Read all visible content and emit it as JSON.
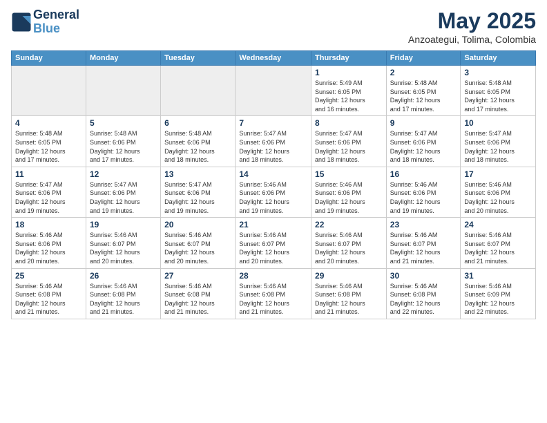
{
  "header": {
    "logo_line1": "General",
    "logo_line2": "Blue",
    "month": "May 2025",
    "location": "Anzoategui, Tolima, Colombia"
  },
  "weekdays": [
    "Sunday",
    "Monday",
    "Tuesday",
    "Wednesday",
    "Thursday",
    "Friday",
    "Saturday"
  ],
  "weeks": [
    [
      {
        "day": "",
        "info": ""
      },
      {
        "day": "",
        "info": ""
      },
      {
        "day": "",
        "info": ""
      },
      {
        "day": "",
        "info": ""
      },
      {
        "day": "1",
        "info": "Sunrise: 5:49 AM\nSunset: 6:05 PM\nDaylight: 12 hours\nand 16 minutes."
      },
      {
        "day": "2",
        "info": "Sunrise: 5:48 AM\nSunset: 6:05 PM\nDaylight: 12 hours\nand 17 minutes."
      },
      {
        "day": "3",
        "info": "Sunrise: 5:48 AM\nSunset: 6:05 PM\nDaylight: 12 hours\nand 17 minutes."
      }
    ],
    [
      {
        "day": "4",
        "info": "Sunrise: 5:48 AM\nSunset: 6:05 PM\nDaylight: 12 hours\nand 17 minutes."
      },
      {
        "day": "5",
        "info": "Sunrise: 5:48 AM\nSunset: 6:06 PM\nDaylight: 12 hours\nand 17 minutes."
      },
      {
        "day": "6",
        "info": "Sunrise: 5:48 AM\nSunset: 6:06 PM\nDaylight: 12 hours\nand 18 minutes."
      },
      {
        "day": "7",
        "info": "Sunrise: 5:47 AM\nSunset: 6:06 PM\nDaylight: 12 hours\nand 18 minutes."
      },
      {
        "day": "8",
        "info": "Sunrise: 5:47 AM\nSunset: 6:06 PM\nDaylight: 12 hours\nand 18 minutes."
      },
      {
        "day": "9",
        "info": "Sunrise: 5:47 AM\nSunset: 6:06 PM\nDaylight: 12 hours\nand 18 minutes."
      },
      {
        "day": "10",
        "info": "Sunrise: 5:47 AM\nSunset: 6:06 PM\nDaylight: 12 hours\nand 18 minutes."
      }
    ],
    [
      {
        "day": "11",
        "info": "Sunrise: 5:47 AM\nSunset: 6:06 PM\nDaylight: 12 hours\nand 19 minutes."
      },
      {
        "day": "12",
        "info": "Sunrise: 5:47 AM\nSunset: 6:06 PM\nDaylight: 12 hours\nand 19 minutes."
      },
      {
        "day": "13",
        "info": "Sunrise: 5:47 AM\nSunset: 6:06 PM\nDaylight: 12 hours\nand 19 minutes."
      },
      {
        "day": "14",
        "info": "Sunrise: 5:46 AM\nSunset: 6:06 PM\nDaylight: 12 hours\nand 19 minutes."
      },
      {
        "day": "15",
        "info": "Sunrise: 5:46 AM\nSunset: 6:06 PM\nDaylight: 12 hours\nand 19 minutes."
      },
      {
        "day": "16",
        "info": "Sunrise: 5:46 AM\nSunset: 6:06 PM\nDaylight: 12 hours\nand 19 minutes."
      },
      {
        "day": "17",
        "info": "Sunrise: 5:46 AM\nSunset: 6:06 PM\nDaylight: 12 hours\nand 20 minutes."
      }
    ],
    [
      {
        "day": "18",
        "info": "Sunrise: 5:46 AM\nSunset: 6:06 PM\nDaylight: 12 hours\nand 20 minutes."
      },
      {
        "day": "19",
        "info": "Sunrise: 5:46 AM\nSunset: 6:07 PM\nDaylight: 12 hours\nand 20 minutes."
      },
      {
        "day": "20",
        "info": "Sunrise: 5:46 AM\nSunset: 6:07 PM\nDaylight: 12 hours\nand 20 minutes."
      },
      {
        "day": "21",
        "info": "Sunrise: 5:46 AM\nSunset: 6:07 PM\nDaylight: 12 hours\nand 20 minutes."
      },
      {
        "day": "22",
        "info": "Sunrise: 5:46 AM\nSunset: 6:07 PM\nDaylight: 12 hours\nand 20 minutes."
      },
      {
        "day": "23",
        "info": "Sunrise: 5:46 AM\nSunset: 6:07 PM\nDaylight: 12 hours\nand 21 minutes."
      },
      {
        "day": "24",
        "info": "Sunrise: 5:46 AM\nSunset: 6:07 PM\nDaylight: 12 hours\nand 21 minutes."
      }
    ],
    [
      {
        "day": "25",
        "info": "Sunrise: 5:46 AM\nSunset: 6:08 PM\nDaylight: 12 hours\nand 21 minutes."
      },
      {
        "day": "26",
        "info": "Sunrise: 5:46 AM\nSunset: 6:08 PM\nDaylight: 12 hours\nand 21 minutes."
      },
      {
        "day": "27",
        "info": "Sunrise: 5:46 AM\nSunset: 6:08 PM\nDaylight: 12 hours\nand 21 minutes."
      },
      {
        "day": "28",
        "info": "Sunrise: 5:46 AM\nSunset: 6:08 PM\nDaylight: 12 hours\nand 21 minutes."
      },
      {
        "day": "29",
        "info": "Sunrise: 5:46 AM\nSunset: 6:08 PM\nDaylight: 12 hours\nand 21 minutes."
      },
      {
        "day": "30",
        "info": "Sunrise: 5:46 AM\nSunset: 6:08 PM\nDaylight: 12 hours\nand 22 minutes."
      },
      {
        "day": "31",
        "info": "Sunrise: 5:46 AM\nSunset: 6:09 PM\nDaylight: 12 hours\nand 22 minutes."
      }
    ]
  ]
}
